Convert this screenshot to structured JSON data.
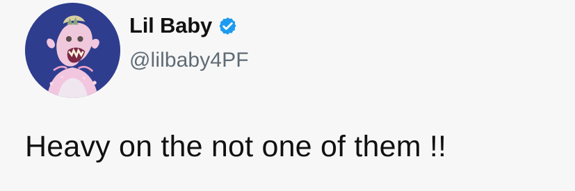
{
  "tweet": {
    "display_name": "Lil Baby",
    "handle": "@lilbaby4PF",
    "text": "Heavy on the not one of them !!",
    "verified": true,
    "verified_color": "#1d9bf0",
    "avatar_background": "#2f3d8e",
    "avatar_icon": "pink-ape-avatar"
  }
}
